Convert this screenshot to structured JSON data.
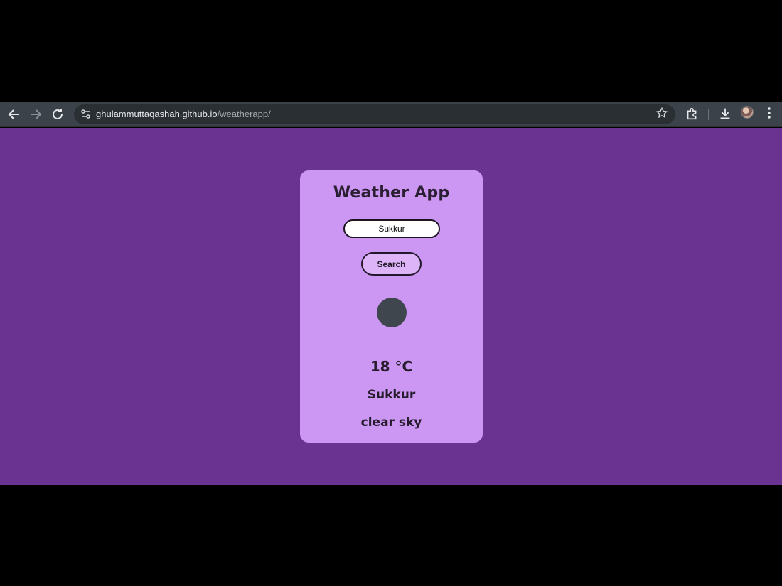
{
  "browser": {
    "url_host": "ghulammuttaqashah.github.io",
    "url_path": "/weatherapp/",
    "icons": {
      "back": "arrow-left-icon",
      "forward": "arrow-right-icon",
      "reload": "reload-icon",
      "site_info": "tune-icon",
      "bookmark": "star-icon",
      "extensions": "puzzle-icon",
      "downloads": "download-icon",
      "menu": "kebab-icon"
    }
  },
  "app": {
    "title": "Weather App",
    "search": {
      "value": "Sukkur",
      "button_label": "Search"
    },
    "result": {
      "temperature": "18 °C",
      "city": "Sukkur",
      "description": "clear sky"
    }
  },
  "colors": {
    "page_background": "#6a3391",
    "card_background": "#cc96f3",
    "button_background": "#dcb4f7",
    "icon_placeholder": "#3f464e"
  }
}
